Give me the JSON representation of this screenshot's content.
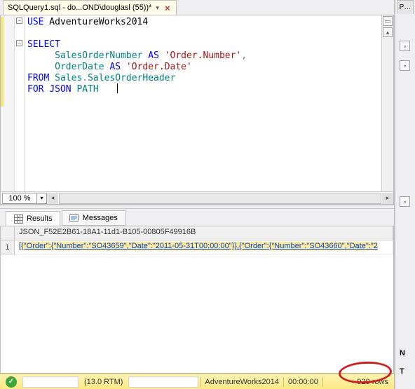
{
  "tab": {
    "title": "SQLQuery1.sql - do...OND\\douglasl (55))*",
    "close_glyph": "×",
    "dropdown_glyph": "▾"
  },
  "editor": {
    "code_tokens": [
      [
        {
          "c": "kw",
          "t": "USE"
        },
        {
          "c": "",
          "t": " AdventureWorks2014"
        }
      ],
      [],
      [
        {
          "c": "kw",
          "t": "SELECT"
        }
      ],
      [
        {
          "c": "",
          "t": "     "
        },
        {
          "c": "id",
          "t": "SalesOrderNumber"
        },
        {
          "c": "",
          "t": " "
        },
        {
          "c": "kw",
          "t": "AS"
        },
        {
          "c": "",
          "t": " "
        },
        {
          "c": "str",
          "t": "'Order.Number'"
        },
        {
          "c": "gray",
          "t": ","
        }
      ],
      [
        {
          "c": "",
          "t": "     "
        },
        {
          "c": "id",
          "t": "OrderDate"
        },
        {
          "c": "",
          "t": " "
        },
        {
          "c": "kw",
          "t": "AS"
        },
        {
          "c": "",
          "t": " "
        },
        {
          "c": "str",
          "t": "'Order.Date'"
        }
      ],
      [
        {
          "c": "kw",
          "t": "FROM"
        },
        {
          "c": "",
          "t": " "
        },
        {
          "c": "id",
          "t": "Sales"
        },
        {
          "c": "gray",
          "t": "."
        },
        {
          "c": "id",
          "t": "SalesOrderHeader"
        }
      ],
      [
        {
          "c": "kw",
          "t": "FOR"
        },
        {
          "c": "",
          "t": " "
        },
        {
          "c": "kw",
          "t": "JSON"
        },
        {
          "c": "",
          "t": " "
        },
        {
          "c": "id",
          "t": "PATH"
        }
      ]
    ],
    "zoom": "100 %",
    "zoom_caret": "▾",
    "split_glyph": "▭",
    "up_glyph": "▴"
  },
  "results": {
    "tab_results": "Results",
    "tab_messages": "Messages",
    "column_header": "JSON_F52E2B61-18A1-11d1-B105-00805F49916B",
    "row_number": "1",
    "cell_value": "[{\"Order\":{\"Number\":\"SO43659\",\"Date\":\"2011-05-31T00:00:00\"}},{\"Order\":{\"Number\":\"SO43660\",\"Date\":\"2"
  },
  "status": {
    "ok_glyph": "✓",
    "server_version": "(13.0 RTM)",
    "database": "AdventureWorks2014",
    "elapsed": "00:00:00",
    "rowcount": "929 rows"
  },
  "aux": {
    "label": "P…"
  }
}
